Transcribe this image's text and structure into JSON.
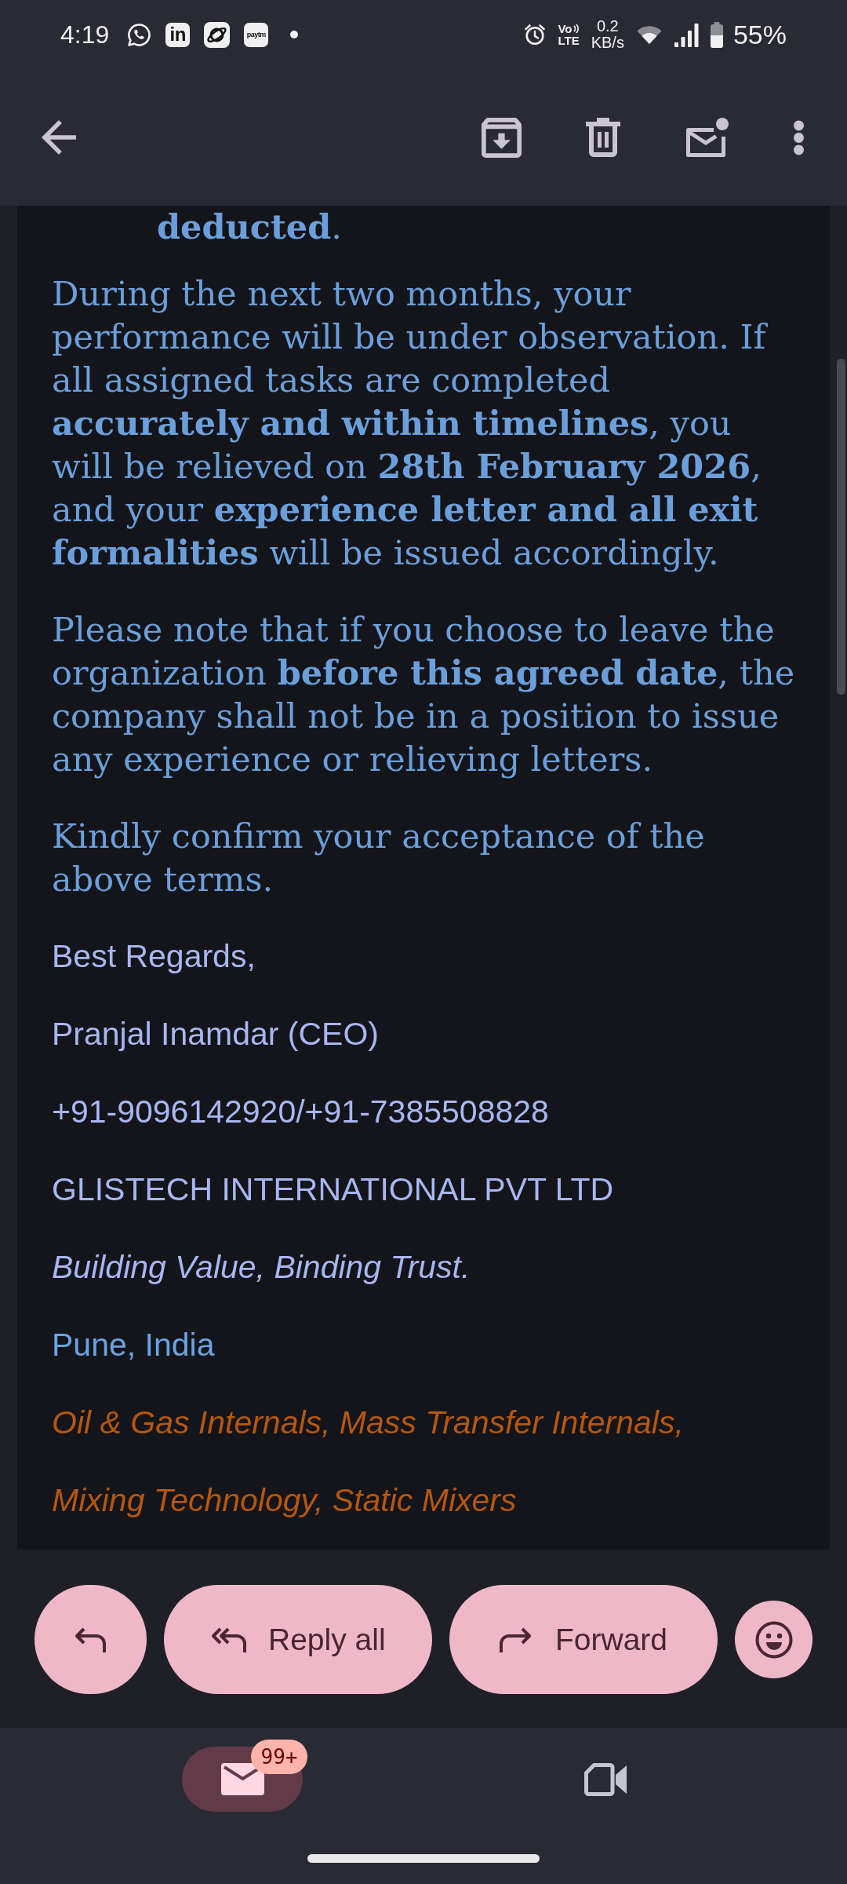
{
  "status_bar": {
    "time": "4:19",
    "notifications": [
      {
        "kind": "bubble"
      },
      {
        "kind": "tile",
        "label": "in"
      },
      {
        "kind": "orbit"
      },
      {
        "kind": "tile",
        "label": "paytm"
      },
      {
        "kind": "dot"
      }
    ],
    "volte": {
      "top": "Vo",
      "bottom": "LTE"
    },
    "data_rate": {
      "value": "0.2",
      "unit": "KB/s"
    },
    "battery": "55%"
  },
  "message_body": [
    {
      "kind": "indent",
      "text": "**deducted**."
    },
    {
      "kind": "paragraph",
      "text": "During the next two months, your performance will be under observation. If all assigned tasks are completed **accurately and within timelines**, you will be relieved on **28th February 2026**, and your **experience letter and all exit formalities** will be issued accordingly."
    },
    {
      "kind": "paragraph",
      "text": "Please note that if you choose to leave the organization **before this agreed date**, the company shall not be in a position to issue any experience or relieving letters."
    },
    {
      "kind": "paragraph",
      "text": "Kindly confirm your acceptance of the above terms."
    }
  ],
  "signature": [
    {
      "kind": "plain",
      "text": "Best Regards,"
    },
    {
      "kind": "plain",
      "text": "Pranjal Inamdar (CEO)"
    },
    {
      "kind": "plain",
      "text": "+91-9096142920/+91-7385508828"
    },
    {
      "kind": "plain",
      "text": "GLISTECH INTERNATIONAL PVT LTD"
    },
    {
      "kind": "italic",
      "text": "Building Value, Binding Trust."
    },
    {
      "kind": "location",
      "text": "Pune, India"
    },
    {
      "kind": "services",
      "text": "Oil & Gas Internals, Mass Transfer Internals,"
    },
    {
      "kind": "services",
      "text": "Mixing Technology, Static Mixers"
    }
  ],
  "actions": [
    {
      "kind": "reply"
    },
    {
      "kind": "reply_all",
      "label": "Reply all"
    },
    {
      "kind": "forward",
      "label": "Forward"
    },
    {
      "kind": "react"
    }
  ],
  "bottom_nav": [
    {
      "kind": "mail",
      "selected": true,
      "badge": "99+"
    },
    {
      "kind": "video",
      "selected": false
    }
  ]
}
